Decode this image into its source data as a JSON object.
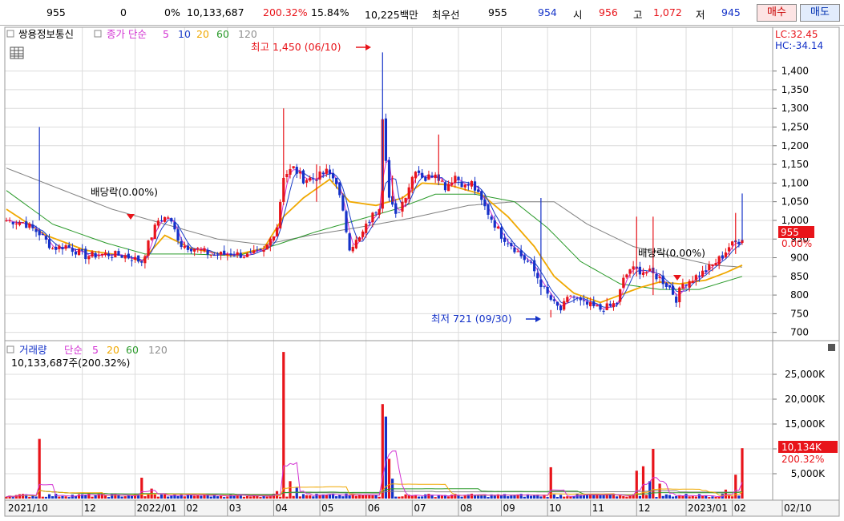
{
  "quote_bar": {
    "price": "955",
    "change": "0",
    "change_rate": "0%",
    "volume": "10,133,687",
    "volume_ratio": "200.32%",
    "turnover_rate": "15.84%",
    "trade_amount": "10,225백만",
    "best_bid_label": "최우선",
    "best_ask": "955",
    "best_bid": "954",
    "open_label": "시",
    "open": "956",
    "high_label": "고",
    "high": "1,072",
    "low_label": "저",
    "low": "945",
    "buy_label": "매수",
    "sell_label": "매도"
  },
  "colors": {
    "up": "#e8141a",
    "down": "#1432c8",
    "ma5": "#d232d2",
    "ma10": "#1a3cc8",
    "ma20": "#f0a800",
    "ma60": "#2a9a2a",
    "ma120": "#808080",
    "grid": "#dcdcdc"
  },
  "chart_data": [
    {
      "type": "candlestick",
      "title": "쌍용정보통신",
      "indicator_label": "종가 단순",
      "ma_periods": [
        "5",
        "10",
        "20",
        "60",
        "120"
      ],
      "lc_label": "LC:32.45",
      "hc_label": "HC:-34.14",
      "ylim": [
        680,
        1440
      ],
      "y_ticks": [
        "1,400",
        "1,350",
        "1,300",
        "1,250",
        "1,200",
        "1,150",
        "1,100",
        "1,050",
        "1,000",
        "950",
        "900",
        "850",
        "800",
        "750",
        "700"
      ],
      "y_tick_values": [
        1400,
        1350,
        1300,
        1250,
        1200,
        1150,
        1100,
        1050,
        1000,
        950,
        900,
        850,
        800,
        750,
        700
      ],
      "current_price_label": "955",
      "current_change_label": "0.00%",
      "annotations": {
        "high": "최고 1,450 (06/10)",
        "low": "최저 721 (09/30)",
        "dividend_1": "배당락(0.00%)",
        "dividend_2": "배당락(0.00%)"
      },
      "x_labels": [
        "2021/10",
        "12",
        "2022/01",
        "02",
        "03",
        "04",
        "05",
        "06",
        "07",
        "08",
        "09",
        "10",
        "11",
        "12",
        "2023/01",
        "02",
        "02/10"
      ],
      "close_path": [
        [
          0,
          1000
        ],
        [
          5,
          995
        ],
        [
          10,
          965
        ],
        [
          14,
          925
        ],
        [
          18,
          932
        ],
        [
          24,
          905
        ],
        [
          30,
          910
        ],
        [
          36,
          905
        ],
        [
          41,
          890
        ],
        [
          44,
          960
        ],
        [
          46,
          1000
        ],
        [
          49,
          1010
        ],
        [
          53,
          935
        ],
        [
          58,
          922
        ],
        [
          63,
          906
        ],
        [
          68,
          912
        ],
        [
          73,
          905
        ],
        [
          78,
          915
        ],
        [
          82,
          985
        ],
        [
          84,
          1120
        ],
        [
          87,
          1140
        ],
        [
          90,
          1110
        ],
        [
          94,
          1115
        ],
        [
          97,
          1130
        ],
        [
          100,
          1105
        ],
        [
          104,
          930
        ],
        [
          107,
          950
        ],
        [
          110,
          1000
        ],
        [
          113,
          1040
        ],
        [
          114,
          1280
        ],
        [
          116,
          1060
        ],
        [
          118,
          1010
        ],
        [
          121,
          1070
        ],
        [
          124,
          1140
        ],
        [
          127,
          1110
        ],
        [
          130,
          1130
        ],
        [
          133,
          1090
        ],
        [
          136,
          1120
        ],
        [
          139,
          1090
        ],
        [
          141,
          1100
        ],
        [
          144,
          1050
        ],
        [
          147,
          1005
        ],
        [
          150,
          960
        ],
        [
          153,
          935
        ],
        [
          156,
          905
        ],
        [
          159,
          880
        ],
        [
          162,
          830
        ],
        [
          164,
          800
        ],
        [
          166,
          775
        ],
        [
          168,
          760
        ],
        [
          171,
          800
        ],
        [
          174,
          780
        ],
        [
          177,
          770
        ],
        [
          180,
          762
        ],
        [
          183,
          770
        ],
        [
          185,
          780
        ],
        [
          187,
          840
        ],
        [
          189,
          870
        ],
        [
          192,
          865
        ],
        [
          195,
          860
        ],
        [
          198,
          845
        ],
        [
          201,
          820
        ],
        [
          203,
          790
        ],
        [
          205,
          830
        ],
        [
          208,
          845
        ],
        [
          211,
          860
        ],
        [
          214,
          880
        ],
        [
          217,
          905
        ],
        [
          219,
          930
        ],
        [
          222,
          945
        ],
        [
          223,
          955
        ]
      ],
      "ma20_path": [
        [
          0,
          1030
        ],
        [
          12,
          960
        ],
        [
          24,
          920
        ],
        [
          36,
          905
        ],
        [
          41,
          890
        ],
        [
          48,
          960
        ],
        [
          56,
          925
        ],
        [
          68,
          905
        ],
        [
          78,
          925
        ],
        [
          84,
          1010
        ],
        [
          90,
          1060
        ],
        [
          98,
          1110
        ],
        [
          104,
          1050
        ],
        [
          112,
          1040
        ],
        [
          120,
          1060
        ],
        [
          126,
          1100
        ],
        [
          134,
          1095
        ],
        [
          144,
          1070
        ],
        [
          152,
          1010
        ],
        [
          160,
          930
        ],
        [
          166,
          850
        ],
        [
          172,
          805
        ],
        [
          180,
          780
        ],
        [
          186,
          800
        ],
        [
          192,
          820
        ],
        [
          198,
          835
        ],
        [
          204,
          830
        ],
        [
          212,
          840
        ],
        [
          218,
          860
        ],
        [
          223,
          880
        ]
      ],
      "ma60_path": [
        [
          0,
          1080
        ],
        [
          14,
          990
        ],
        [
          30,
          940
        ],
        [
          42,
          910
        ],
        [
          56,
          910
        ],
        [
          70,
          905
        ],
        [
          82,
          935
        ],
        [
          94,
          970
        ],
        [
          106,
          1000
        ],
        [
          118,
          1030
        ],
        [
          130,
          1070
        ],
        [
          142,
          1070
        ],
        [
          154,
          1050
        ],
        [
          164,
          980
        ],
        [
          174,
          890
        ],
        [
          186,
          830
        ],
        [
          198,
          815
        ],
        [
          210,
          815
        ],
        [
          223,
          850
        ]
      ],
      "ma120_path": [
        [
          0,
          1140
        ],
        [
          16,
          1085
        ],
        [
          32,
          1030
        ],
        [
          48,
          990
        ],
        [
          64,
          950
        ],
        [
          78,
          935
        ],
        [
          92,
          960
        ],
        [
          106,
          980
        ],
        [
          122,
          1005
        ],
        [
          140,
          1040
        ],
        [
          154,
          1050
        ],
        [
          166,
          1050
        ],
        [
          176,
          990
        ],
        [
          190,
          930
        ],
        [
          204,
          900
        ],
        [
          214,
          880
        ],
        [
          223,
          875
        ]
      ]
    },
    {
      "type": "bar",
      "title": "거래량",
      "indicator_label": "단순",
      "ma_periods": [
        "5",
        "20",
        "60",
        "120"
      ],
      "volume_label": "10,133,687주(200.32%)",
      "ylim": [
        0,
        30000
      ],
      "y_ticks": [
        "25,000K",
        "20,000K",
        "15,000K",
        "10,000K",
        "5,000K"
      ],
      "y_tick_values": [
        25000,
        20000,
        15000,
        10000,
        5000
      ],
      "current_label": "10,134K",
      "current_ratio_label": "200.32%",
      "spikes": [
        {
          "i": 10,
          "v": 12000,
          "up": true
        },
        {
          "i": 41,
          "v": 4200,
          "up": true
        },
        {
          "i": 44,
          "v": 2000,
          "up": true
        },
        {
          "i": 82,
          "v": 1500,
          "up": true
        },
        {
          "i": 84,
          "v": 29500,
          "up": true
        },
        {
          "i": 86,
          "v": 3500,
          "up": true
        },
        {
          "i": 88,
          "v": 2200,
          "up": false
        },
        {
          "i": 114,
          "v": 19000,
          "up": true
        },
        {
          "i": 115,
          "v": 16500,
          "up": false
        },
        {
          "i": 116,
          "v": 8000,
          "up": true
        },
        {
          "i": 117,
          "v": 4000,
          "up": false
        },
        {
          "i": 165,
          "v": 6300,
          "up": true
        },
        {
          "i": 191,
          "v": 5600,
          "up": true
        },
        {
          "i": 193,
          "v": 6500,
          "up": true
        },
        {
          "i": 195,
          "v": 3500,
          "up": false
        },
        {
          "i": 196,
          "v": 10000,
          "up": true
        },
        {
          "i": 198,
          "v": 3000,
          "up": true
        },
        {
          "i": 218,
          "v": 1800,
          "up": true
        },
        {
          "i": 221,
          "v": 4800,
          "up": true
        },
        {
          "i": 223,
          "v": 10134,
          "up": true
        }
      ]
    }
  ]
}
